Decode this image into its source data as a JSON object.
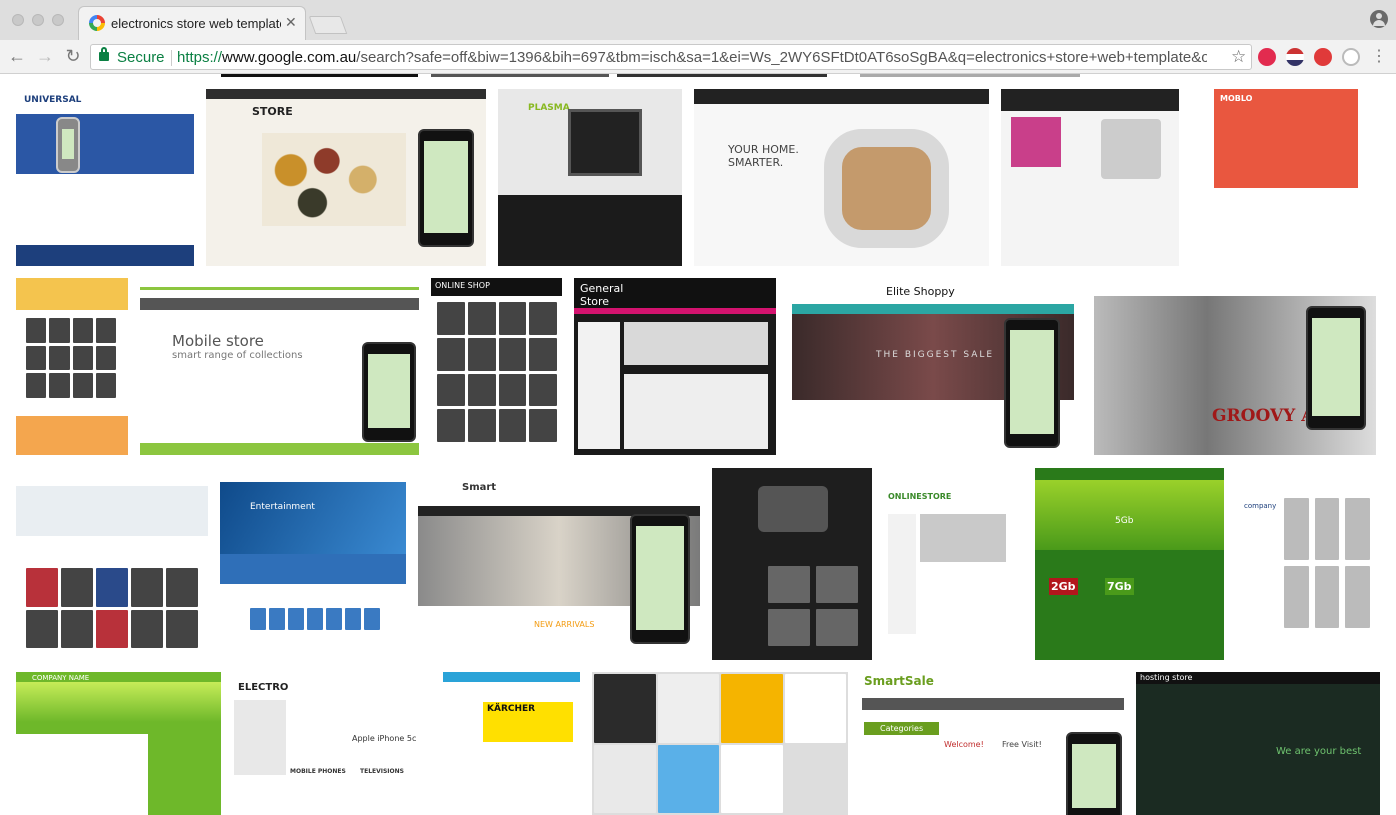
{
  "browser": {
    "tab": {
      "title": "electronics store web template"
    },
    "security_label": "Secure",
    "url_scheme": "https://",
    "url_host": "www.google.com.au",
    "url_path": "/search?safe=off&biw=1396&bih=697&tbm=isch&sa=1&ei=Ws_2WY6SFtDt0AT6soSgBA&q=electronics+store+web+template&oq..."
  },
  "thumbnails": {
    "t1": "UNIVERSAL",
    "t2": "STORE",
    "t3": "PLASMA",
    "t4": "YOUR HOME. SMARTER.",
    "t6": "MOBLO",
    "t8": "Mobile store",
    "t8b": "smart range of collections",
    "t9": "ONLINE SHOP",
    "t10": "General Store",
    "t11": "Elite Shoppy",
    "t11b": "THE BIGGEST SALE",
    "t12": "GROOVY A",
    "t14": "Entertainment",
    "t15": "Smart",
    "t15b": "NEW ARRIVALS",
    "t17": "ONLINESTORE",
    "t18": "5Gb",
    "t18b": "2Gb",
    "t18c": "7Gb",
    "t19": "company",
    "t20": "COMPANY NAME",
    "t21": "ELECTRO",
    "t21b": "Apple iPhone 5c",
    "t21c": "MOBILE PHONES",
    "t21d": "TELEVISIONS",
    "t22": "KÄRCHER",
    "t24": "SmartSale",
    "t24b": "Categories",
    "t24c": "Welcome!",
    "t24d": "Free Visit!",
    "t25": "hosting store",
    "t25b": "We are your best"
  }
}
